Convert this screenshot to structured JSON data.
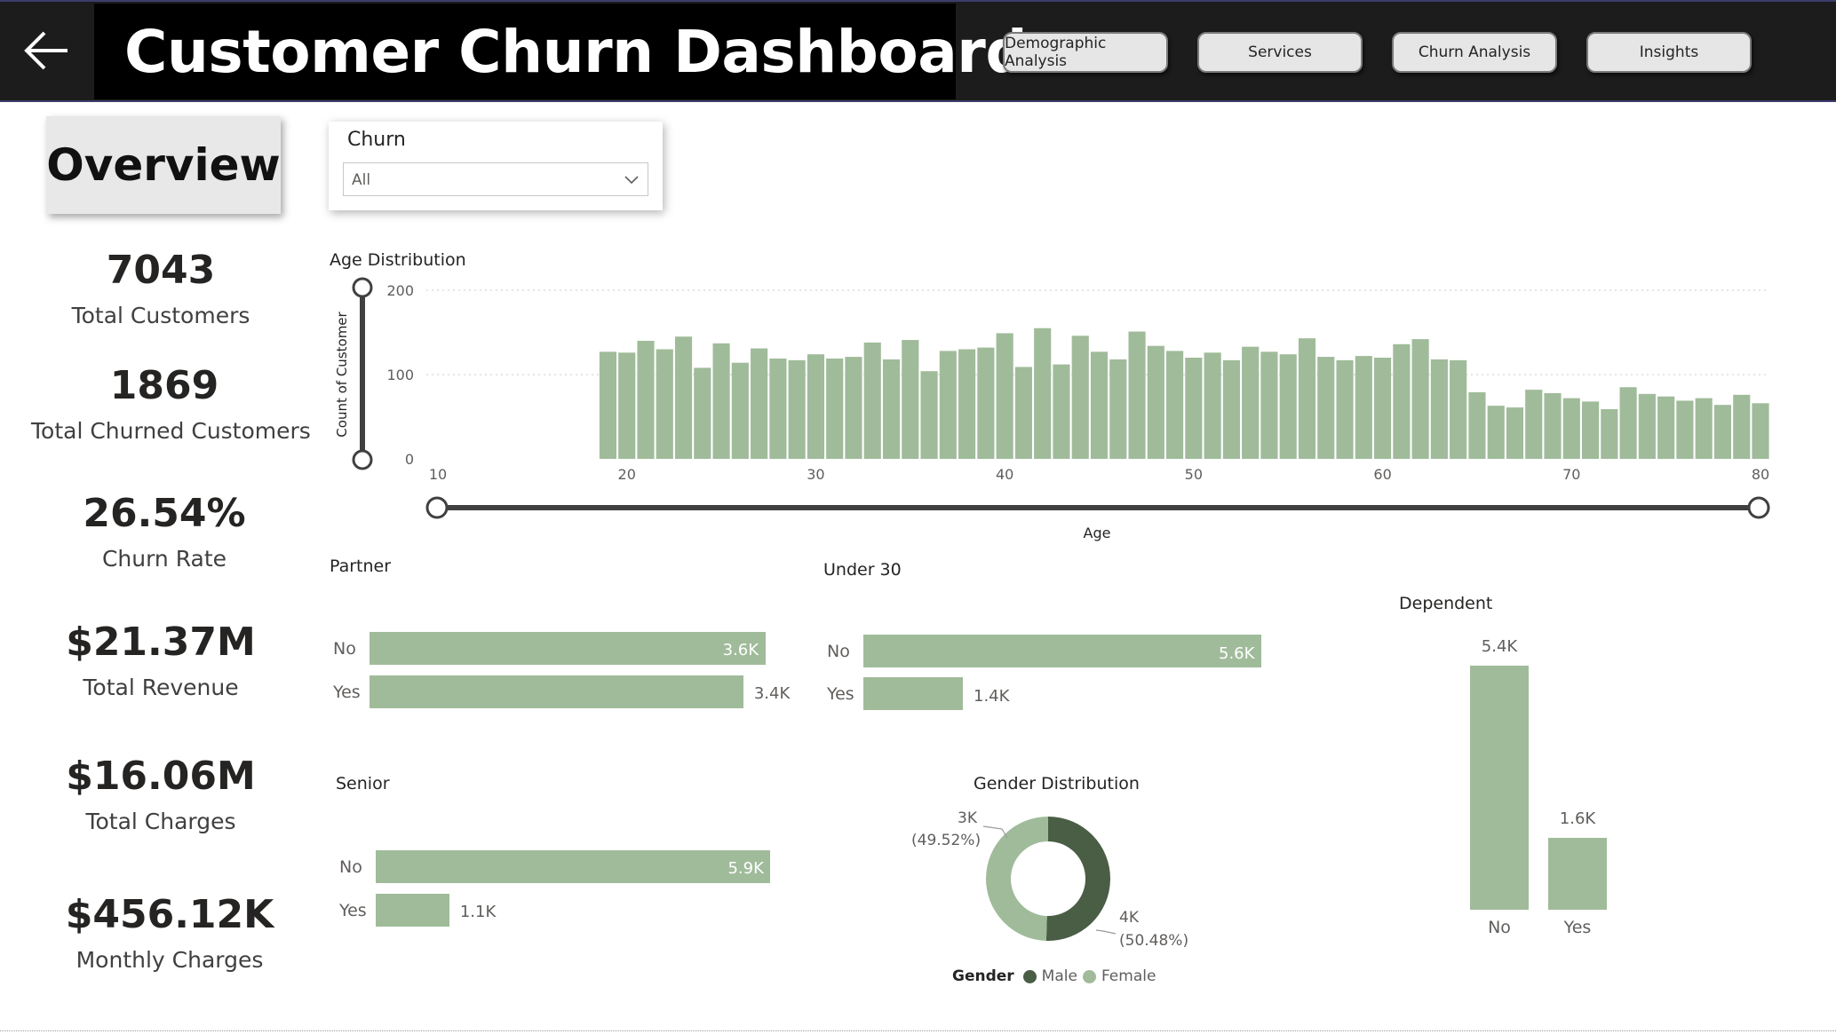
{
  "header": {
    "title": "Customer Churn Dashboard",
    "back_icon": "arrow-left-icon",
    "nav": [
      "Demographic Analysis",
      "Services",
      "Churn Analysis",
      "Insights"
    ]
  },
  "overview": {
    "title": "Overview",
    "kpis": [
      {
        "value": "7043",
        "label": "Total Customers"
      },
      {
        "value": "1869",
        "label": "Total Churned Customers"
      },
      {
        "value": "26.54%",
        "label": "Churn Rate"
      },
      {
        "value": "$21.37M",
        "label": "Total Revenue"
      },
      {
        "value": "$16.06M",
        "label": "Total Charges"
      },
      {
        "value": "$456.12K",
        "label": "Monthly Charges"
      }
    ]
  },
  "slicer": {
    "title": "Churn",
    "value": "All",
    "chevron_icon": "chevron-down-icon"
  },
  "colors": {
    "bar": "#a0bb9a",
    "male": "#4a5d45",
    "female": "#a0bb9a",
    "header": "#1c1c1c"
  },
  "chart_data": [
    {
      "type": "bar",
      "title": "Age Distribution",
      "xlabel": "Age",
      "ylabel": "Count of Customer",
      "xlim": [
        10,
        80
      ],
      "ylim": [
        0,
        200
      ],
      "xticks": [
        "10",
        "20",
        "30",
        "40",
        "50",
        "60",
        "70",
        "80"
      ],
      "yticks": [
        "0",
        "100",
        "200"
      ],
      "grid": true,
      "x": [
        19,
        20,
        21,
        22,
        23,
        24,
        25,
        26,
        27,
        28,
        29,
        30,
        31,
        32,
        33,
        34,
        35,
        36,
        37,
        38,
        39,
        40,
        41,
        42,
        43,
        44,
        45,
        46,
        47,
        48,
        49,
        50,
        51,
        52,
        53,
        54,
        55,
        56,
        57,
        58,
        59,
        60,
        61,
        62,
        63,
        64,
        65,
        66,
        67,
        68,
        69,
        70,
        71,
        72,
        73,
        74,
        75,
        76,
        77,
        78,
        79,
        80
      ],
      "values": [
        127,
        126,
        140,
        130,
        145,
        108,
        137,
        114,
        131,
        119,
        117,
        124,
        119,
        121,
        138,
        118,
        141,
        104,
        128,
        130,
        132,
        149,
        109,
        155,
        112,
        146,
        127,
        118,
        151,
        134,
        128,
        120,
        126,
        117,
        133,
        127,
        124,
        143,
        121,
        117,
        122,
        120,
        136,
        142,
        118,
        117,
        79,
        63,
        61,
        82,
        78,
        72,
        68,
        59,
        85,
        77,
        74,
        69,
        72,
        64,
        76,
        66
      ]
    },
    {
      "type": "bar",
      "title": "Partner",
      "categories": [
        "No",
        "Yes"
      ],
      "values": [
        3.6,
        3.4
      ],
      "labels": [
        "3.6K",
        "3.4K"
      ],
      "xlim": [
        0,
        3.7
      ]
    },
    {
      "type": "bar",
      "title": "Under 30",
      "categories": [
        "No",
        "Yes"
      ],
      "values": [
        5.6,
        1.4
      ],
      "labels": [
        "5.6K",
        "1.4K"
      ],
      "xlim": [
        0,
        5.7
      ]
    },
    {
      "type": "bar",
      "title": "Senior",
      "categories": [
        "No",
        "Yes"
      ],
      "values": [
        5.9,
        1.1
      ],
      "labels": [
        "5.9K",
        "1.1K"
      ],
      "xlim": [
        0,
        6.0
      ]
    },
    {
      "type": "bar",
      "title": "Dependent",
      "categories": [
        "No",
        "Yes"
      ],
      "values": [
        5.4,
        1.6
      ],
      "labels": [
        "5.4K",
        "1.6K"
      ],
      "ylim": [
        0,
        5.4
      ]
    },
    {
      "type": "pie",
      "title": "Gender Distribution",
      "legend_title": "Gender",
      "legend_position": "bottom",
      "series": [
        {
          "name": "Male",
          "value": 50.48,
          "label": "4K",
          "pct_label": "(50.48%)"
        },
        {
          "name": "Female",
          "value": 49.52,
          "label": "3K",
          "pct_label": "(49.52%)"
        }
      ]
    }
  ]
}
